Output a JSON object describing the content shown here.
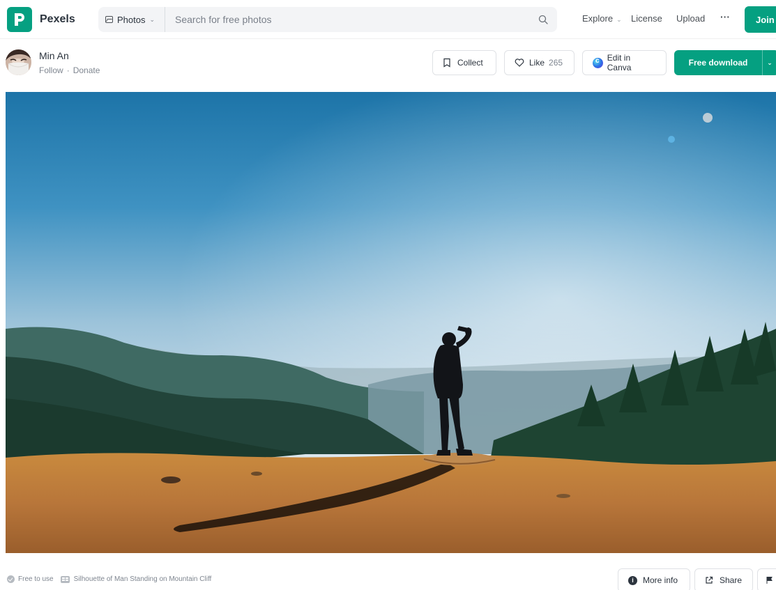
{
  "header": {
    "brand": "Pexels",
    "search": {
      "type_label": "Photos",
      "placeholder": "Search for free photos"
    },
    "nav": {
      "explore": "Explore",
      "license": "License",
      "upload": "Upload",
      "more": "···",
      "join": "Join"
    }
  },
  "author": {
    "name": "Min An",
    "follow": "Follow",
    "separator": "·",
    "donate": "Donate"
  },
  "actions": {
    "collect": "Collect",
    "like": "Like",
    "like_count": "265",
    "edit_canva": "Edit in Canva",
    "download": "Free download"
  },
  "photo_info": {
    "license": "Free to use",
    "title": "Silhouette of Man Standing on Mountain Cliff"
  },
  "footer_actions": {
    "more_info": "More info",
    "share": "Share"
  },
  "colors": {
    "brand": "#05a081",
    "text": "#2c343e",
    "muted": "#7f8690"
  },
  "icons": [
    "pexels-logo-icon",
    "image-icon",
    "search-icon",
    "bookmark-icon",
    "heart-icon",
    "canva-icon",
    "chevron-down-icon",
    "check-circle-icon",
    "caption-icon",
    "info-icon",
    "share-icon",
    "flag-icon"
  ]
}
